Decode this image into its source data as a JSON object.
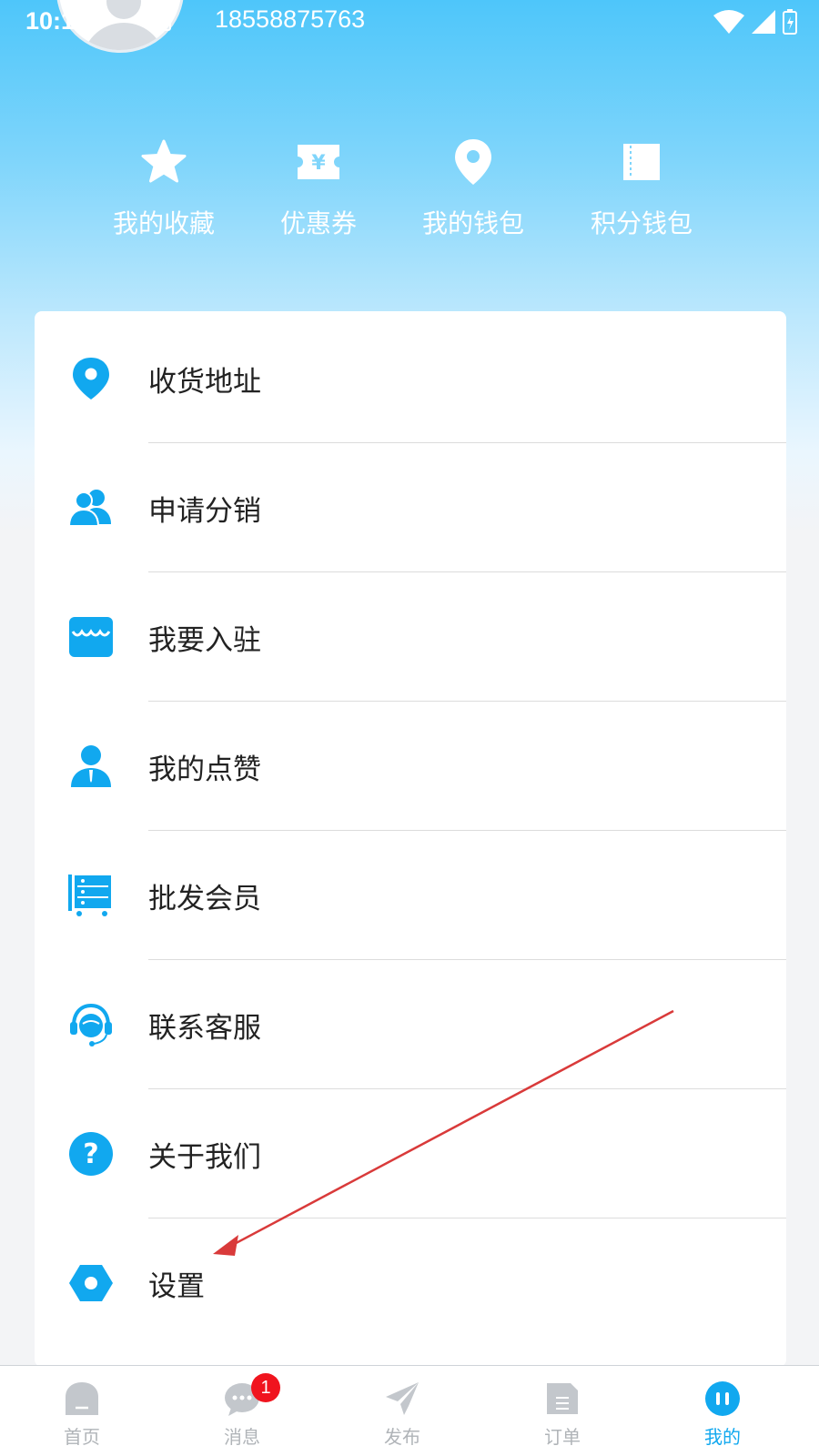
{
  "status_bar": {
    "time": "10:19",
    "notification_icon": "A"
  },
  "profile": {
    "phone": "18558875763"
  },
  "quick_actions": [
    {
      "label": "我的收藏",
      "icon": "star-icon"
    },
    {
      "label": "优惠券",
      "icon": "coupon-icon"
    },
    {
      "label": "我的钱包",
      "icon": "location-pin-icon"
    },
    {
      "label": "积分钱包",
      "icon": "ticket-icon"
    }
  ],
  "menu": [
    {
      "label": "收货地址",
      "icon": "location-pin-icon"
    },
    {
      "label": "申请分销",
      "icon": "users-icon"
    },
    {
      "label": "我要入驻",
      "icon": "store-icon"
    },
    {
      "label": "我的点赞",
      "icon": "person-icon"
    },
    {
      "label": "批发会员",
      "icon": "cart-rack-icon"
    },
    {
      "label": "联系客服",
      "icon": "headset-icon"
    },
    {
      "label": "关于我们",
      "icon": "question-icon"
    },
    {
      "label": "设置",
      "icon": "settings-hex-icon"
    }
  ],
  "tabbar": [
    {
      "label": "首页",
      "icon": "home-icon"
    },
    {
      "label": "消息",
      "icon": "message-icon",
      "badge": "1"
    },
    {
      "label": "发布",
      "icon": "paper-plane-icon"
    },
    {
      "label": "订单",
      "icon": "order-doc-icon"
    },
    {
      "label": "我的",
      "icon": "profile-icon",
      "active": true
    }
  ],
  "colors": {
    "accent": "#11a8ef",
    "header_top": "#4ec6fa",
    "badge": "#f0141e",
    "annotation_arrow": "#d93a3a"
  }
}
